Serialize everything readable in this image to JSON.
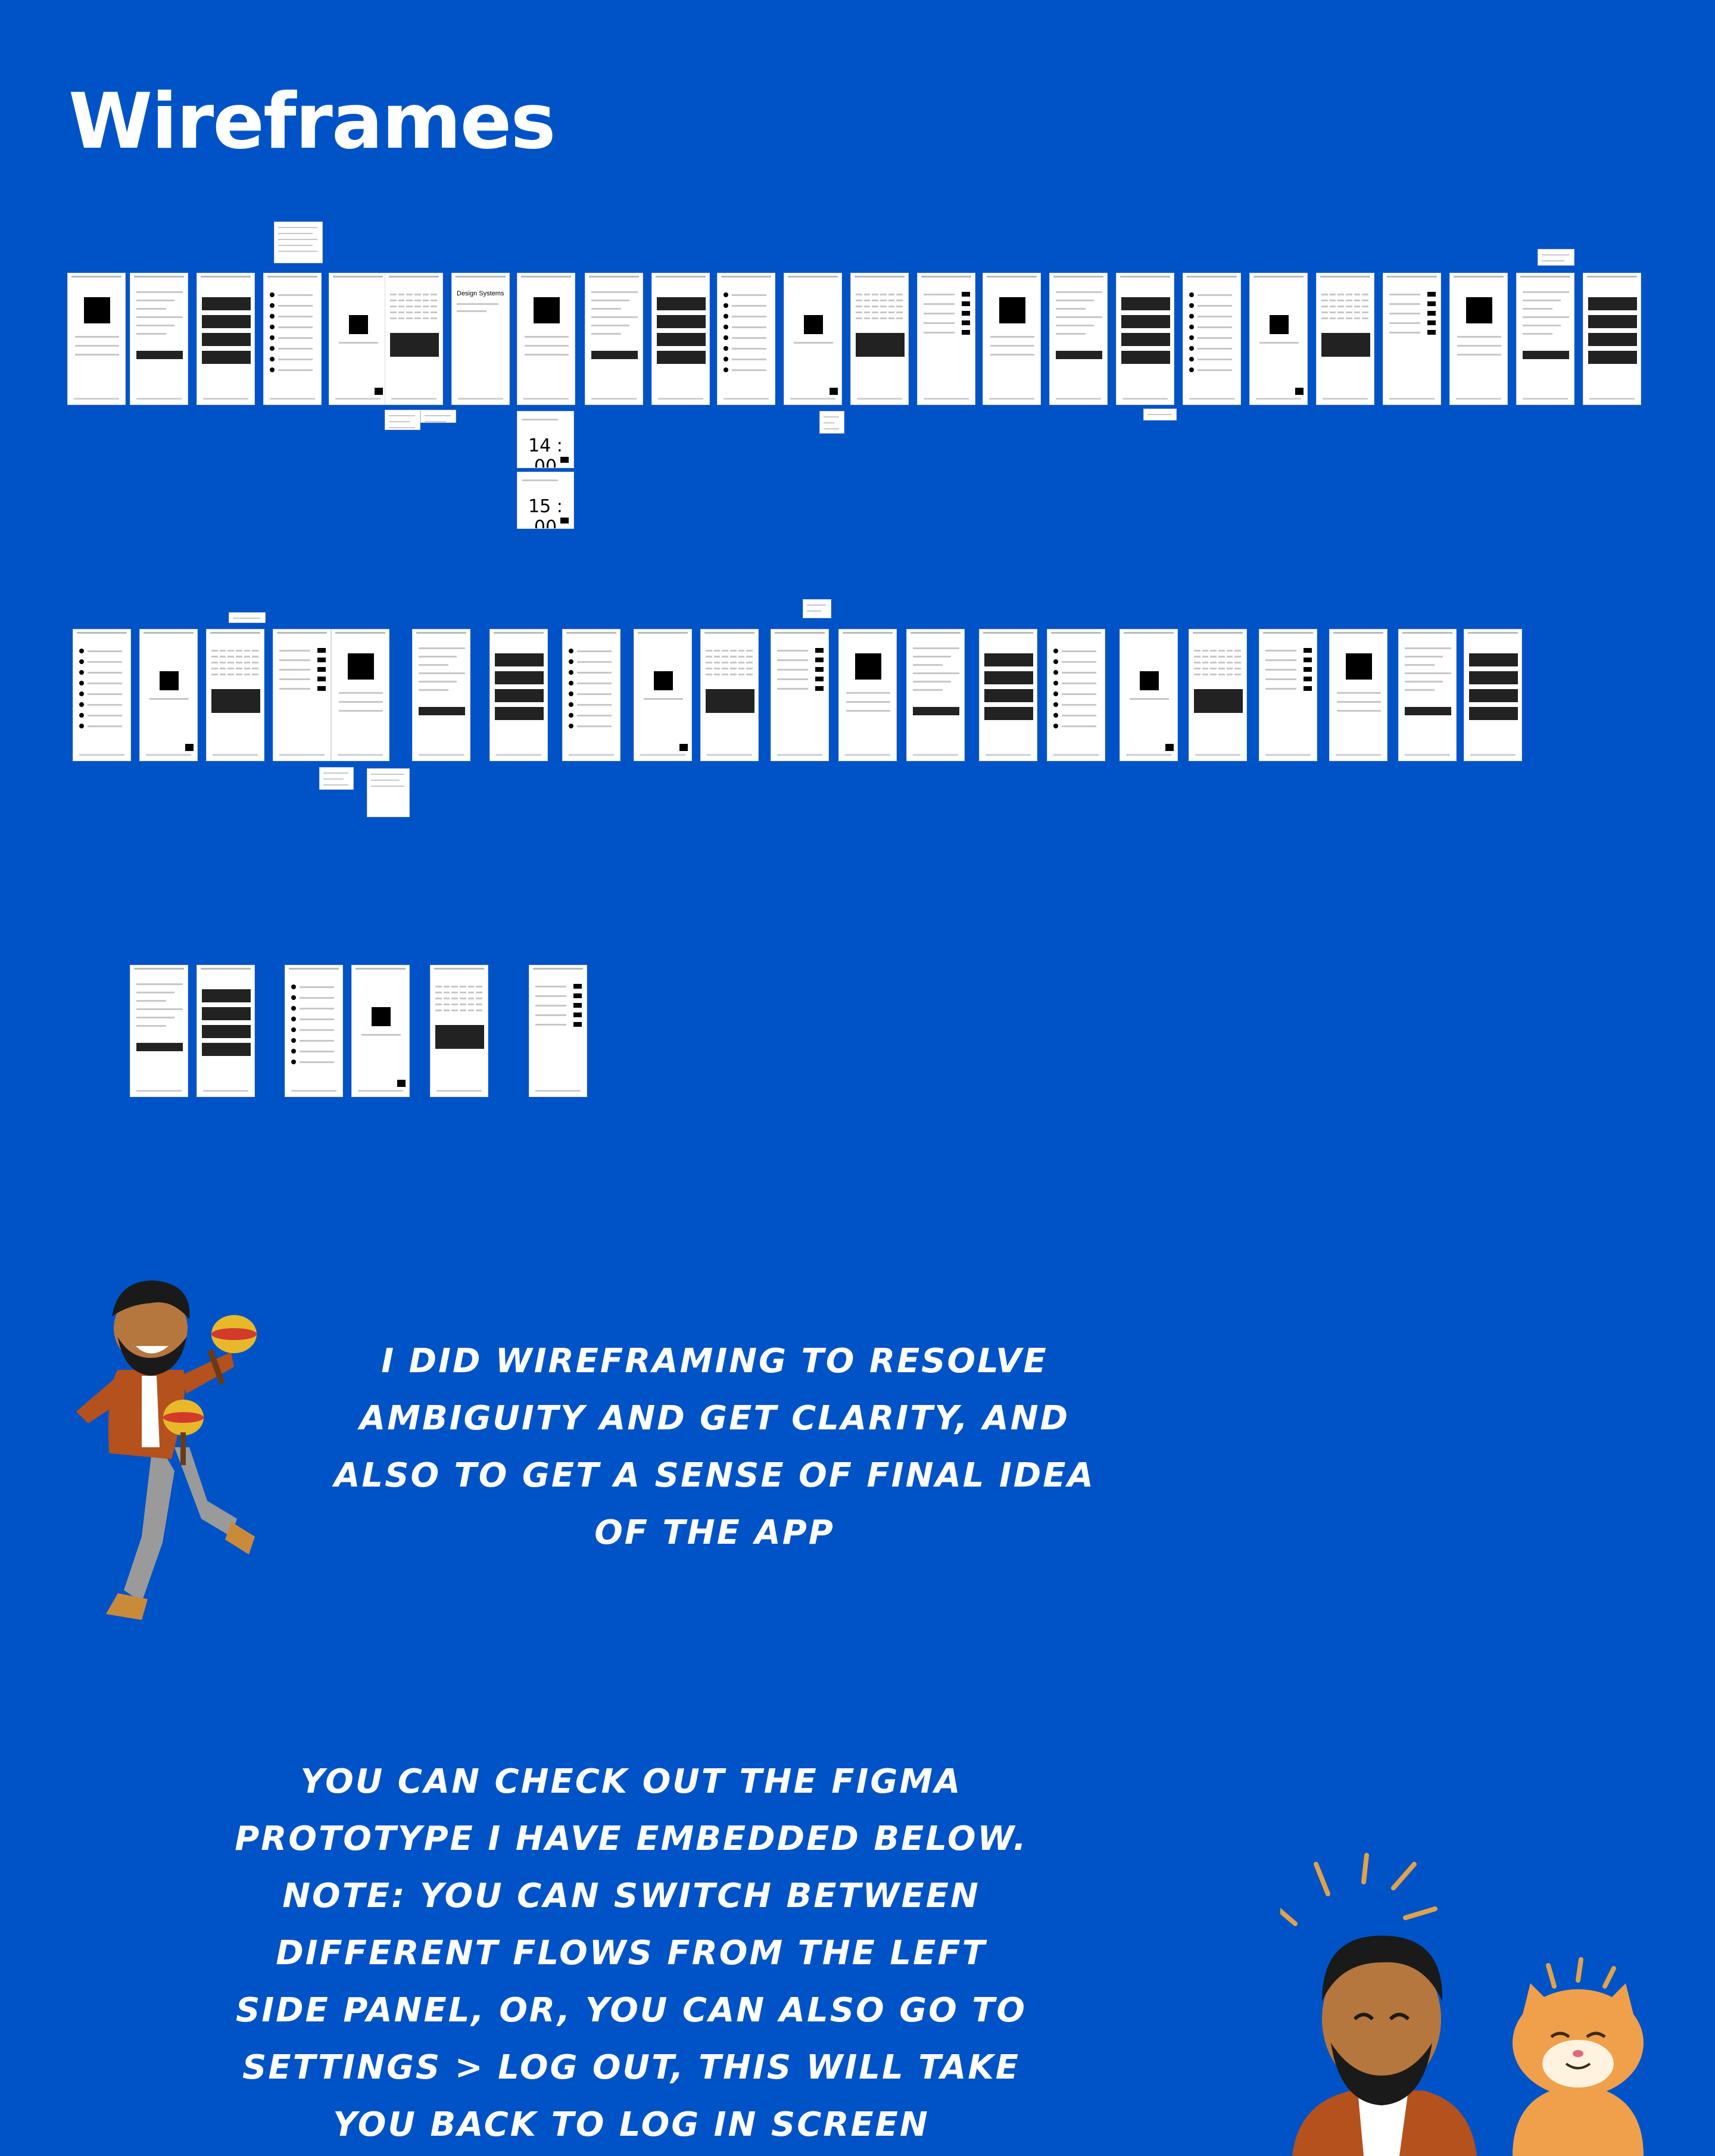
{
  "page": {
    "title": "Wireframes"
  },
  "wireframes": {
    "time_labels": [
      "14 : 00",
      "15 : 00"
    ],
    "frame_heading": "Design Systems"
  },
  "captions": {
    "intro": "I did wireframing to resolve ambiguity and get clarity, and also to get a sense of final idea of the app",
    "prototype": "You can check out the figma prototype I have embedded below. Note: you can switch between different flows from the left side panel, or, you can also go to settings > log out, this will take you back to log in screen"
  },
  "colors": {
    "background": "#0053c7",
    "text": "#ffffff",
    "frame": "#ffffff"
  },
  "icons": [
    "avatar-maracas-illustration",
    "avatar-with-cat-illustration",
    "checkmark-icon"
  ]
}
